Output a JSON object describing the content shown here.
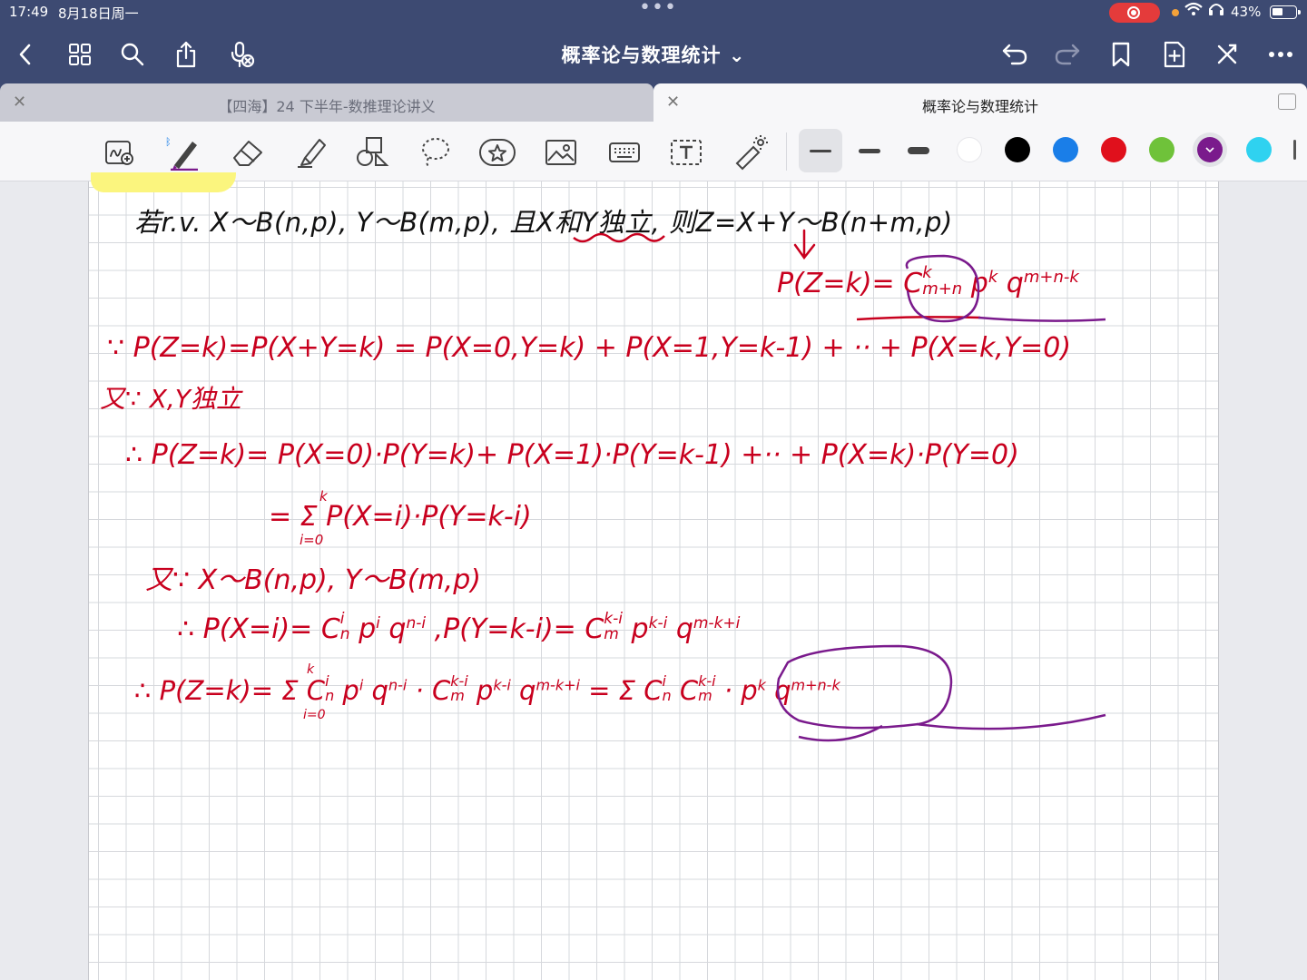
{
  "status": {
    "time": "17:49",
    "date": "8月18日周一",
    "battery": "43%"
  },
  "nav": {
    "title": "概率论与数理统计 ⌄"
  },
  "tabs": [
    {
      "label": "【四海】24 下半年-数推理论讲义"
    },
    {
      "label": "概率论与数理统计"
    }
  ],
  "colors": {
    "nav_bg": "#3d4a72",
    "ink_red": "#c8001e",
    "ink_black": "#111111",
    "ink_purple": "#7a1a8c",
    "palette": [
      "#ffffff",
      "#000000",
      "#1a7ee8",
      "#e0101c",
      "#6fc23a",
      "#7a1a8c",
      "#2fd2f0"
    ]
  },
  "notes": {
    "line1": "若r.v. X～B(n,p), Y～B(m,p), 且X和Y独立, 则Z=X+Y～B(n+m,p)",
    "line2": "P(Z=k)= C",
    "line2_sup": "k",
    "line2_sub": "m+n",
    "line2_tail": " p",
    "line2_tail_sup": "k",
    "line2_q": " q",
    "line2_q_sup": "m+n-k",
    "line3": "∵ P(Z=k)=P(X+Y=k) = P(X=0,Y=k) + P(X=1,Y=k-1) + ·· + P(X=k,Y=0)",
    "line4": "又∵ X,Y独立",
    "line5": "∴ P(Z=k)= P(X=0)·P(Y=k)+ P(X=1)·P(Y=k-1) +·· + P(X=k)·P(Y=0)",
    "line6": "= Σ P(X=i)·P(Y=k-i)",
    "line6_sup": "k",
    "line6_sub": "i=0",
    "line7": "又∵ X～B(n,p), Y～B(m,p)",
    "line8": "∴ P(X=i)= C",
    "line8_a_sup": "i",
    "line8_a_sub": "n",
    "line8_b": " p",
    "line8_b_sup": "i",
    "line8_c": " q",
    "line8_c_sup": "n-i",
    "line8_d": " ,P(Y=k-i)= C",
    "line8_d_sup": "k-i",
    "line8_d_sub": "m",
    "line8_e": " p",
    "line8_e_sup": "k-i",
    "line8_f": " q",
    "line8_f_sup": "m-k+i",
    "line9": "∴ P(Z=k)= Σ C",
    "line9_sigma_sup": "k",
    "line9_sigma_sub": "i=0",
    "line9_c_sup": "i",
    "line9_c_sub": "n",
    "line9_b": " p",
    "line9_b_sup": "i",
    "line9_c": " q",
    "line9_c2_sup": "n-i",
    "line9_d": " · C",
    "line9_d_sup": "k-i",
    "line9_d_sub": "m",
    "line9_e": " p",
    "line9_e_sup": "k-i",
    "line9_f": " q",
    "line9_f_sup": "m-k+i",
    "line9_eq": " = Σ C",
    "line9_g_sup": "i",
    "line9_g_sub": "n",
    "line9_h": " C",
    "line9_h_sup": "k-i",
    "line9_h_sub": "m",
    "line9_i": " · p",
    "line9_i_sup": "k",
    "line9_j": " q",
    "line9_j_sup": "m+n-k"
  }
}
